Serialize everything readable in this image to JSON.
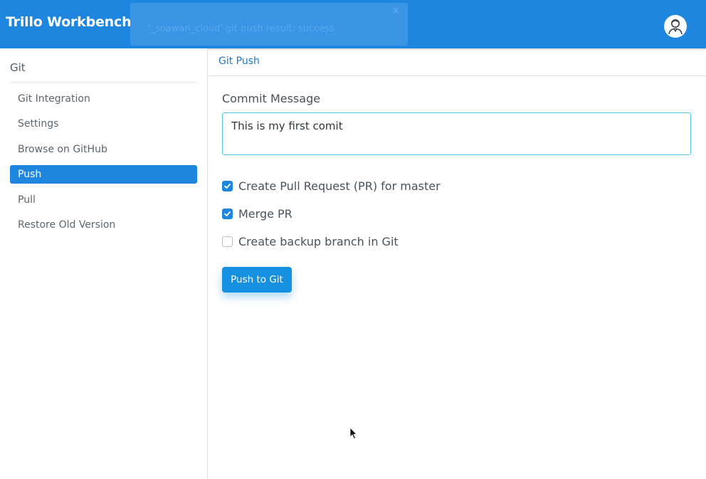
{
  "app": {
    "title": "Trillo Workbench"
  },
  "toast": {
    "message": "'_soawan_cloud' git push result: success",
    "close_glyph": "✕"
  },
  "header": {
    "avatar_icon": "user-avatar-icon"
  },
  "sidebar": {
    "title": "Git",
    "items": [
      {
        "label": "Git Integration",
        "active": false
      },
      {
        "label": "Settings",
        "active": false
      },
      {
        "label": "Browse on GitHub",
        "active": false
      },
      {
        "label": "Push",
        "active": true
      },
      {
        "label": "Pull",
        "active": false
      },
      {
        "label": "Restore Old Version",
        "active": false
      }
    ]
  },
  "main": {
    "breadcrumb": "Git Push",
    "commit_label": "Commit Message",
    "commit_value": "This is my first comit",
    "options": [
      {
        "label": "Create Pull Request (PR) for master",
        "checked": true
      },
      {
        "label": "Merge PR",
        "checked": true
      },
      {
        "label": "Create backup branch in Git",
        "checked": false
      }
    ],
    "push_button": "Push to Git"
  },
  "colors": {
    "primary": "#1f86e0",
    "link": "#1f78c8",
    "input_border": "#52c4df"
  }
}
